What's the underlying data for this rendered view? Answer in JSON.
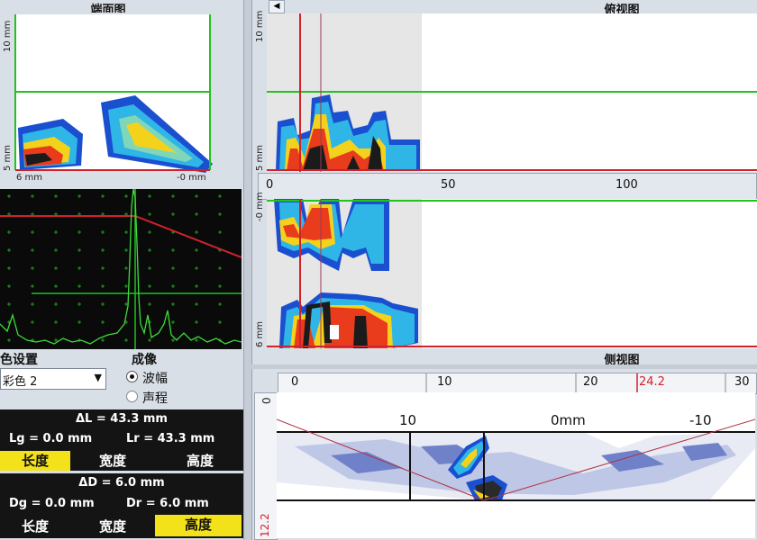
{
  "views": {
    "end": {
      "title": "端面图",
      "y_top": "10 mm",
      "y_bottom": "5 mm",
      "x_left": "6 mm",
      "x_right": "-0 mm"
    },
    "top": {
      "title": "俯视图",
      "y_top": "10 mm",
      "y_bottom": "5 mm",
      "x_ticks": [
        "0",
        "50",
        "100"
      ]
    },
    "lower": {
      "y_top": "-0 mm",
      "y_bottom": "6 mm"
    },
    "side": {
      "title": "侧视图",
      "ruler_ticks": [
        "0",
        "10",
        "20",
        "30"
      ],
      "cursor": "24.2",
      "y_top": "0",
      "y_bottom": "12.2",
      "scan_labels": [
        "10",
        "0mm",
        "-10"
      ]
    }
  },
  "color_settings": {
    "label": "色设置",
    "palette": "彩色 2"
  },
  "imaging": {
    "label": "成像",
    "options": [
      {
        "label": "波幅",
        "checked": true
      },
      {
        "label": "声程",
        "checked": false
      }
    ]
  },
  "measure1": {
    "delta": "ΔL = 43.3 mm",
    "a": "Lg = 0.0 mm",
    "b": "Lr = 43.3 mm",
    "buttons": [
      "长度",
      "宽度",
      "高度"
    ],
    "active": 0
  },
  "measure2": {
    "delta": "ΔD = 6.0 mm",
    "a": "Dg = 0.0 mm",
    "b": "Dr = 6.0 mm",
    "buttons": [
      "长度",
      "宽度",
      "高度"
    ],
    "active": 2
  },
  "colors": {
    "green": "#22c21f",
    "red": "#d0222d",
    "yellow": "#f3e11a"
  }
}
